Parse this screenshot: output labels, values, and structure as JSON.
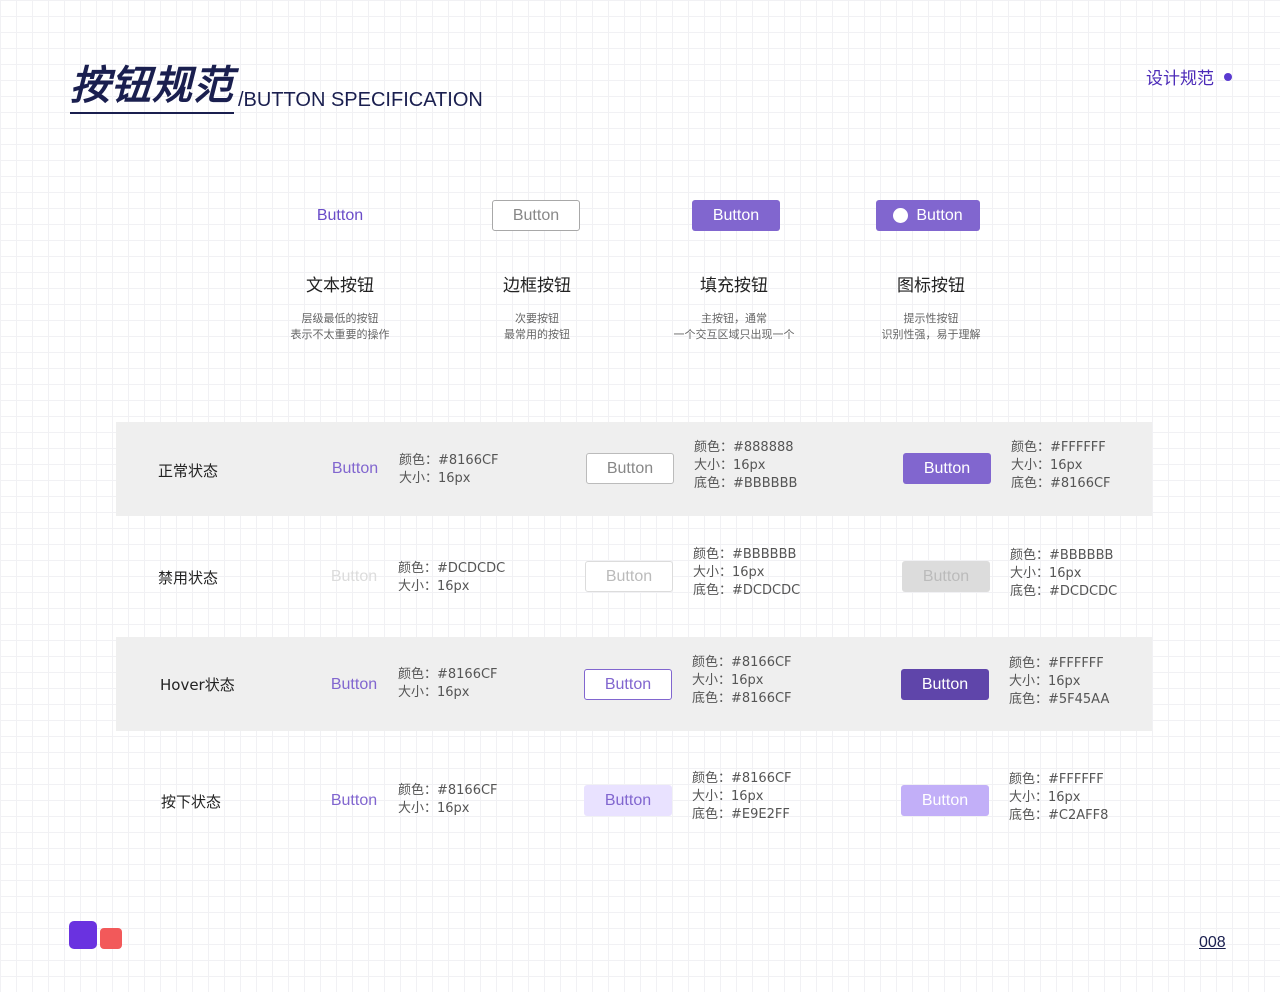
{
  "header": {
    "title_cn": "按钮规范",
    "title_en": "/BUTTON SPECIFICATION",
    "top_right": "设计规范"
  },
  "overview": [
    {
      "button_label": "Button",
      "title": "文本按钮",
      "desc_line1": "层级最低的按钮",
      "desc_line2": "表示不太重要的操作"
    },
    {
      "button_label": "Button",
      "title": "边框按钮",
      "desc_line1": "次要按钮",
      "desc_line2": "最常用的按钮"
    },
    {
      "button_label": "Button",
      "title": "填充按钮",
      "desc_line1": "主按钮，通常",
      "desc_line2": "一个交互区域只出现一个"
    },
    {
      "button_label": "Button",
      "title": "图标按钮",
      "desc_line1": "提示性按钮",
      "desc_line2": "识别性强，易于理解"
    }
  ],
  "states": [
    {
      "label": "正常状态",
      "text_btn": {
        "label": "Button",
        "color": "颜色：#8166CF",
        "size": "大小：16px"
      },
      "outline_btn": {
        "label": "Button",
        "color": "颜色：#888888",
        "size": "大小：16px",
        "bg": "底色：#BBBBBB"
      },
      "fill_btn": {
        "label": "Button",
        "color": "颜色：#FFFFFF",
        "size": "大小：16px",
        "bg": "底色：#8166CF"
      }
    },
    {
      "label": "禁用状态",
      "text_btn": {
        "label": "Button",
        "color": "颜色：#DCDCDC",
        "size": "大小：16px"
      },
      "outline_btn": {
        "label": "Button",
        "color": "颜色：#BBBBBB",
        "size": "大小：16px",
        "bg": "底色：#DCDCDC"
      },
      "fill_btn": {
        "label": "Button",
        "color": "颜色：#BBBBBB",
        "size": "大小：16px",
        "bg": "底色：#DCDCDC"
      }
    },
    {
      "label": "Hover状态",
      "text_btn": {
        "label": "Button",
        "color": "颜色：#8166CF",
        "size": "大小：16px"
      },
      "outline_btn": {
        "label": "Button",
        "color": "颜色：#8166CF",
        "size": "大小：16px",
        "bg": "底色：#8166CF"
      },
      "fill_btn": {
        "label": "Button",
        "color": "颜色：#FFFFFF",
        "size": "大小：16px",
        "bg": "底色：#5F45AA"
      }
    },
    {
      "label": "按下状态",
      "text_btn": {
        "label": "Button",
        "color": "颜色：#8166CF",
        "size": "大小：16px"
      },
      "outline_btn": {
        "label": "Button",
        "color": "颜色：#8166CF",
        "size": "大小：16px",
        "bg": "底色：#E9E2FF"
      },
      "fill_btn": {
        "label": "Button",
        "color": "颜色：#FFFFFF",
        "size": "大小：16px",
        "bg": "底色：#C2AFF8"
      }
    }
  ],
  "colors": {
    "primary": "#8166CF",
    "hover": "#5F45AA",
    "pressed": "#C2AFF8",
    "pressed_light": "#E9E2FF",
    "disabled": "#DCDCDC"
  },
  "footer": {
    "page_number": "008"
  }
}
